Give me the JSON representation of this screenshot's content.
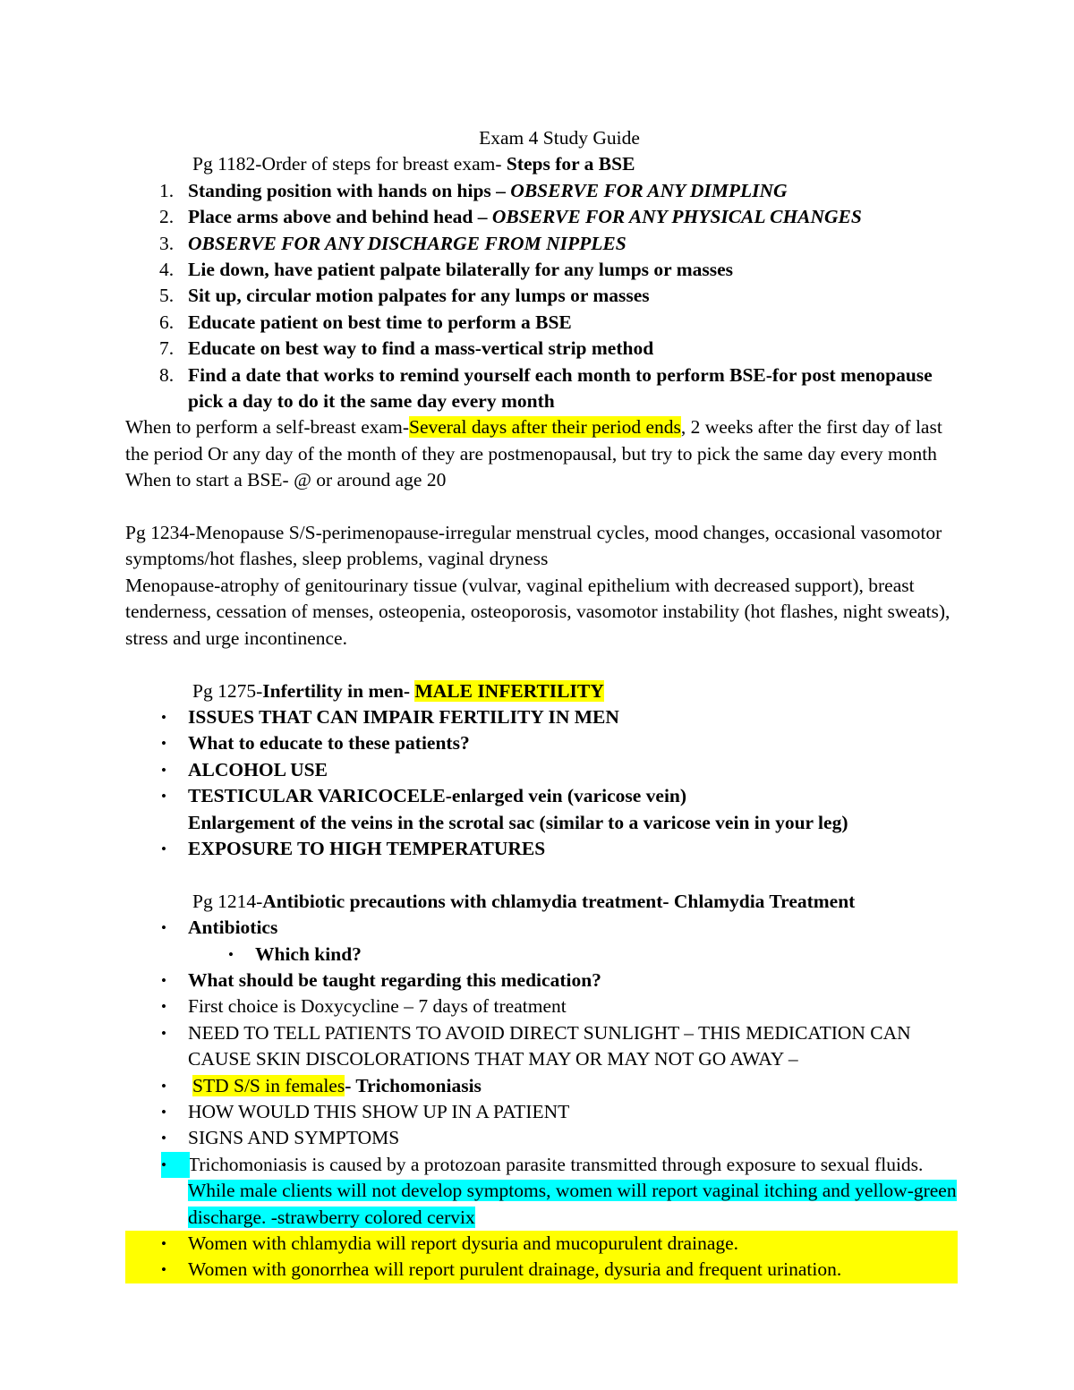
{
  "document": {
    "title": "Exam 4 Study Guide",
    "colors": {
      "highlight_yellow": "#ffff00",
      "highlight_cyan": "#00ffff",
      "text": "#000000",
      "page_background": "#ffffff"
    }
  },
  "sections": {
    "bse": {
      "heading_prefix": "Pg 1182-Order of steps for breast exam- ",
      "heading_bold": "Steps for a BSE",
      "steps": [
        {
          "number": "1.",
          "bold_text": "Standing position with hands on hips – ",
          "italic_text": "OBSERVE FOR ANY DIMPLING"
        },
        {
          "number": "2.",
          "bold_text": "Place arms above and behind head – ",
          "italic_text": "OBSERVE FOR ANY PHYSICAL CHANGES"
        },
        {
          "number": "3.",
          "bold_text": "",
          "italic_text": "OBSERVE FOR ANY DISCHARGE FROM NIPPLES"
        },
        {
          "number": "4.",
          "bold_text": "Lie down, have patient palpate bilaterally for any lumps or masses",
          "italic_text": ""
        },
        {
          "number": "5.",
          "bold_text": "Sit up, circular motion palpates for any lumps or masses",
          "italic_text": ""
        },
        {
          "number": "6.",
          "bold_text": "Educate patient on best time to perform a BSE",
          "italic_text": ""
        },
        {
          "number": "7.",
          "bold_text": "Educate on best way to find a mass-vertical strip method",
          "italic_text": ""
        },
        {
          "number": "8.",
          "bold_text": "Find a date that works to remind yourself each month to perform BSE-for post menopause pick a day to do it the same day every month",
          "italic_text": ""
        }
      ],
      "when_to_perform_lead": "When to perform a self-breast exam-",
      "when_to_perform_highlight": "Several days after their period ends",
      "when_to_perform_rest": ", 2 weeks after the first day of last the period Or any day of the month of they are postmenopausal, but try to pick the same day every month",
      "when_to_start": "When to start a BSE- @ or around age 20"
    },
    "menopause": {
      "line1": "Pg 1234-Menopause S/S-perimenopause-irregular menstrual cycles, mood changes, occasional vasomotor symptoms/hot flashes, sleep problems, vaginal dryness",
      "line2": "Menopause-atrophy of genitourinary tissue (vulvar, vaginal epithelium with decreased support), breast tenderness, cessation of menses, osteopenia, osteoporosis, vasomotor instability (hot flashes, night sweats), stress and urge incontinence."
    },
    "male_infertility": {
      "heading_prefix": "Pg 1275-",
      "heading_bold": "Infertility in men- ",
      "heading_highlight": "MALE INFERTILITY",
      "bullets": [
        "ISSUES THAT CAN IMPAIR FERTILITY IN MEN",
        "What to educate to these patients?",
        "ALCOHOL USE",
        "TESTICULAR VARICOCELE-enlarged vein (varicose vein)",
        "EXPOSURE TO HIGH TEMPERATURES"
      ],
      "varicocele_continuation": "Enlargement of the veins in the scrotal sac (similar to a varicose vein in your leg)"
    },
    "chlamydia": {
      "heading_prefix": "Pg 1214-",
      "heading_bold": "Antibiotic precautions with chlamydia treatment- Chlamydia Treatment",
      "bullet_antibiotics": "Antibiotics",
      "sub_bullet_which_kind": "Which kind?",
      "bullet_what_taught": "What should be taught regarding this medication?",
      "bullet_first_choice": "First choice is Doxycycline – 7 days of treatment",
      "bullet_sunlight": "NEED TO TELL PATIENTS TO AVOID DIRECT SUNLIGHT – THIS MEDICATION CAN CAUSE SKIN DISCOLORATIONS THAT MAY OR MAY NOT GO AWAY –",
      "bullet_empty": ""
    },
    "std_females": {
      "heading_highlight": "STD S/S in females",
      "heading_bold": "- Trichomoniasis",
      "bullet_how_show_up": "HOW WOULD THIS SHOW UP IN A PATIENT",
      "bullet_signs_symptoms": "SIGNS AND SYMPTOMS",
      "trich_part1": "Trichomoniasis is caused by a protozoan parasite transmitted through exposure to sexual fluids.",
      "trich_part2": " While male clients will not develop symptoms, women will report vaginal itching and yellow-green discharge. -strawberry colored cervix",
      "bullet_chlamydia_women": "Women with chlamydia will report dysuria and mucopurulent drainage.",
      "bullet_gonorrhea_women": "Women with gonorrhea will report purulent drainage, dysuria and frequent urination."
    }
  }
}
